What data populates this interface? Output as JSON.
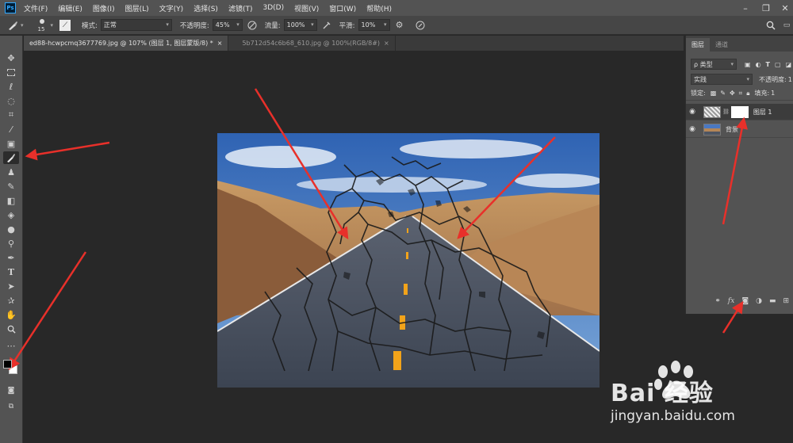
{
  "app": {
    "logo_text": "Ps"
  },
  "menu": [
    "文件(F)",
    "编辑(E)",
    "图像(I)",
    "图层(L)",
    "文字(Y)",
    "选择(S)",
    "滤镜(T)",
    "3D(D)",
    "视图(V)",
    "窗口(W)",
    "帮助(H)"
  ],
  "options": {
    "brush_size": "15",
    "mode_label": "模式:",
    "mode_value": "正常",
    "opacity_label": "不透明度:",
    "opacity_value": "45%",
    "flow_label": "流量:",
    "flow_value": "100%",
    "smooth_label": "平滑:",
    "smooth_value": "10%"
  },
  "tabs": [
    {
      "label": "ed88-hcwpcmq3677769.jpg @ 107% (图层 1, 图层蒙版/8) *",
      "close": "×"
    },
    {
      "label": "5b712d54c6b68_610.jpg @ 100%(RGB/8#)",
      "close": "×"
    }
  ],
  "layers_panel": {
    "tabs": [
      "图层",
      "通道"
    ],
    "filter_value": "ρ 类型",
    "blend_value": "实践",
    "opacity_label": "不透明度:",
    "opacity_value": "1",
    "lock_label": "锁定:",
    "fill_label": "填充:",
    "fill_value": "1",
    "layers": [
      {
        "name": "图层 1",
        "selected": true
      },
      {
        "name": "背景",
        "selected": false
      }
    ],
    "bottom_fx": "fx"
  },
  "watermark": {
    "brand": "Bai  经验",
    "url": "jingyan.baidu.com"
  },
  "colors": {
    "accent": "#31a8ff",
    "arrow": "#e8302a",
    "road_line": "#f2a31a"
  }
}
